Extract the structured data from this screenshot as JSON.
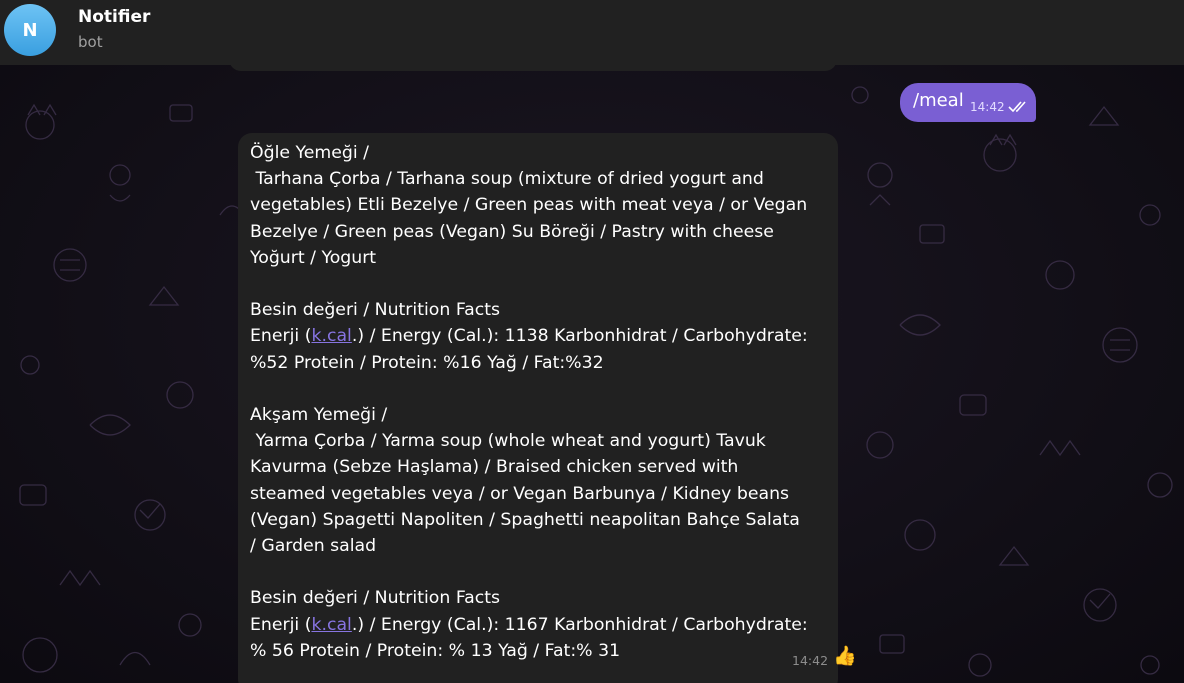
{
  "header": {
    "avatar_letter": "N",
    "chat_title": "Notifier",
    "chat_subtitle": "bot"
  },
  "outgoing": {
    "text": "/meal",
    "time": "14:42",
    "status_icon": "double-check-icon"
  },
  "incoming": {
    "lunch_title": "Öğle Yemeği /",
    "lunch_line1": " Tarhana Çorba / Tarhana soup (mixture of dried yogurt and",
    "lunch_line2": "vegetables) Etli Bezelye / Green peas with meat veya / or Vegan",
    "lunch_line3": "Bezelye / Green peas (Vegan) Su Böreği / Pastry with cheese",
    "lunch_line4": "Yoğurt / Yogurt",
    "lunch_facts_title": "Besin değeri / Nutrition Facts",
    "lunch_facts_prefix": "Enerji (",
    "lunch_facts_link": "k.cal",
    "lunch_facts_suffix": ".) / Energy (Cal.): 1138 Karbonhidrat / Carbohydrate:",
    "lunch_facts_line2": "%52 Protein / Protein: %16 Yağ / Fat:%32",
    "dinner_title": "Akşam Yemeği /",
    "dinner_line1": " Yarma Çorba / Yarma soup (whole wheat and yogurt) Tavuk",
    "dinner_line2": "Kavurma (Sebze Haşlama) / Braised chicken served with",
    "dinner_line3": "steamed vegetables veya / or Vegan Barbunya / Kidney beans",
    "dinner_line4": "(Vegan) Spagetti Napoliten / Spaghetti neapolitan Bahçe Salata",
    "dinner_line5": "/ Garden salad",
    "dinner_facts_title": "Besin değeri / Nutrition Facts",
    "dinner_facts_prefix": "Enerji (",
    "dinner_facts_link": "k.cal",
    "dinner_facts_suffix": ".) / Energy (Cal.): 1167 Karbonhidrat / Carbohydrate:",
    "dinner_facts_line2": "% 56 Protein / Protein: % 13 Yağ / Fat:% 31",
    "time": "14:42",
    "reaction": "👍"
  },
  "colors": {
    "accent": "#7a5fd3",
    "link": "#8774e1",
    "bubble_in": "#212121",
    "header_bg": "#212121"
  }
}
